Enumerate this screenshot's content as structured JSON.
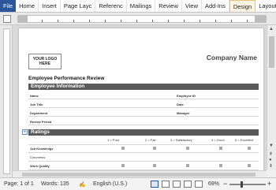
{
  "ribbon": {
    "tabs": [
      {
        "label": "File"
      },
      {
        "label": "Home"
      },
      {
        "label": "Insert"
      },
      {
        "label": "Page Layc"
      },
      {
        "label": "Referenc"
      },
      {
        "label": "Mailings"
      },
      {
        "label": "Review"
      },
      {
        "label": "View"
      },
      {
        "label": "Add-Ins"
      },
      {
        "label": "Design"
      },
      {
        "label": "Layout"
      },
      {
        "label": "♡"
      }
    ],
    "active_tab": "Design"
  },
  "document": {
    "logo": "YOUR LOGO HERE",
    "company": "Company Name",
    "title": "Employee Performance Review",
    "section1": "Employee Information",
    "fields": {
      "name": "Name",
      "employee_id": "Employee ID",
      "job_title": "Job Title",
      "date": "Date",
      "department": "Department",
      "manager": "Manager",
      "review_period": "Review Period"
    },
    "section2": "Ratings",
    "rating_scale": [
      "1 = Poor",
      "2 = Fair",
      "3 = Satisfactory",
      "4 = Good",
      "5 = Excellent"
    ],
    "rating_rows": [
      "Job Knowledge",
      "Comments",
      "Work Quality"
    ]
  },
  "status": {
    "page": "Page: 1 of 1",
    "words": "Words: 135",
    "language": "English (U.S.)",
    "zoom": "69%",
    "minus": "−",
    "plus": "+"
  },
  "colors": {
    "file_tab": "#2b579a",
    "section_bar": "#5a5a5a",
    "active_tab": "#fdf4e0"
  }
}
